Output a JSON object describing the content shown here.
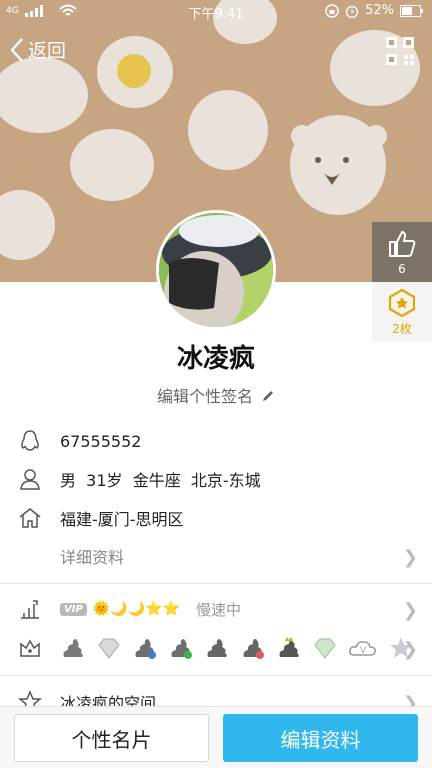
{
  "status_bar": {
    "network": "4G",
    "time": "下午9:41",
    "battery": "52%"
  },
  "header": {
    "back_label": "返回",
    "back_icon": "chevron-left-icon",
    "qr_icon": "qrcode-icon"
  },
  "side": {
    "like_count": "6",
    "star_count": "2枚"
  },
  "profile": {
    "name": "冰凌疯",
    "signature": "编辑个性签名"
  },
  "info": {
    "qq": "67555552",
    "basic": "男  31岁  金牛座  北京-东城",
    "hometown": "福建-厦门-思明区",
    "detail_label": "详细资料"
  },
  "level": {
    "vip": "VIP",
    "level_icons": "🌞🌙🌙⭐⭐",
    "speed": "慢速中"
  },
  "space": {
    "label": "冰凌疯的空间"
  },
  "buttons": {
    "card": "个性名片",
    "edit": "编辑资料"
  },
  "colors": {
    "cover_bg": "#c7a583",
    "accent": "#2fb7ee",
    "star": "#e9a400"
  }
}
